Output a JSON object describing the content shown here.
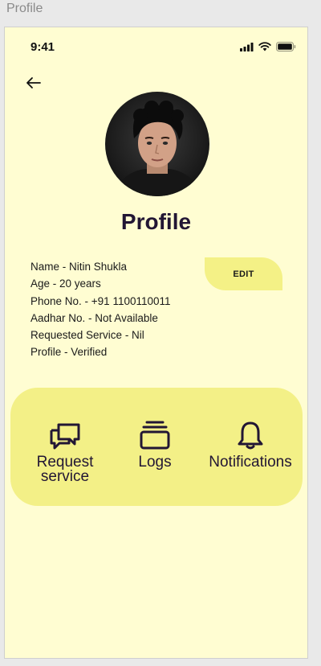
{
  "window": {
    "title": "Profile"
  },
  "status_bar": {
    "time": "9:41"
  },
  "profile": {
    "title": "Profile",
    "name": "Name - Nitin Shukla",
    "age": "Age - 20 years",
    "phone": "Phone No. - +91 1100110011",
    "aadhar": "Aadhar No. - Not Available",
    "requested_service": "Requested Service - Nil",
    "status": "Profile - Verified",
    "edit_label": "EDIT"
  },
  "actions": {
    "request_line1": "Request",
    "request_line2": "service",
    "logs": "Logs",
    "notifications": "Notifications"
  },
  "colors": {
    "background": "#fffdd2",
    "accent": "#f4f186",
    "text_dark": "#221634"
  }
}
